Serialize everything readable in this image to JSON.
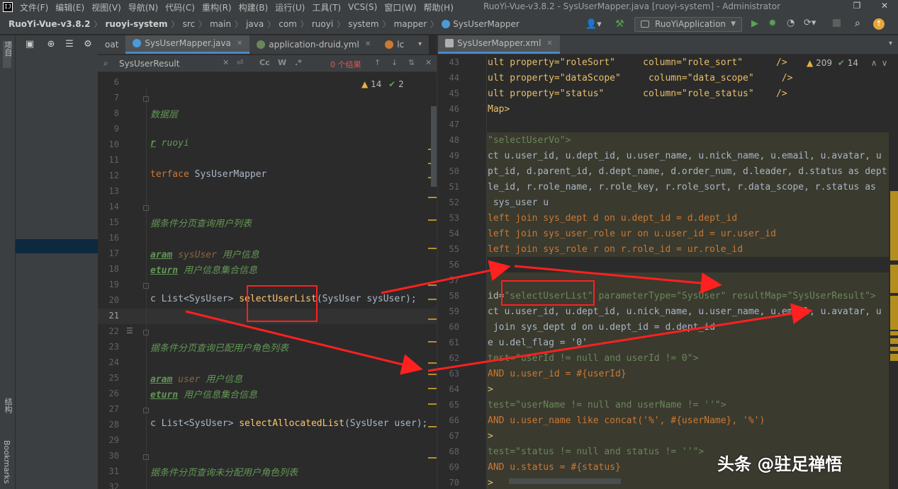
{
  "menubar": {
    "items": [
      "文件(F)",
      "编辑(E)",
      "视图(V)",
      "导航(N)",
      "代码(C)",
      "重构(R)",
      "构建(B)",
      "运行(U)",
      "工具(T)",
      "VCS(S)",
      "窗口(W)",
      "帮助(H)"
    ],
    "window_title": "RuoYi-Vue-v3.8.2 - SysUserMapper.java [ruoyi-system] - Administrator"
  },
  "breadcrumb": [
    "RuoYi-Vue-v3.8.2",
    "ruoyi-system",
    "src",
    "main",
    "java",
    "com",
    "ruoyi",
    "system",
    "mapper",
    "SysUserMapper"
  ],
  "run_config": {
    "label": "RuoYiApplication"
  },
  "side_labels": {
    "project": "项目",
    "structure": "结构",
    "bookmarks": "Bookmarks"
  },
  "left_tabs": [
    {
      "label": "oat",
      "icon_color": "#6a8759"
    },
    {
      "label": "SysUserMapper.java",
      "icon_color": "#4a9bd8",
      "active": true
    },
    {
      "label": "application-druid.yml",
      "icon_color": "#6a8759"
    },
    {
      "label": "lc",
      "icon_color": "#cc7832"
    }
  ],
  "right_tabs": [
    {
      "label": "SysUserMapper.xml",
      "active": true
    }
  ],
  "search": {
    "value": "SysUserResult",
    "result_count": "0 个结果",
    "tool_cc": "Cc",
    "tool_w": "W",
    "tool_regex": ".*"
  },
  "left_inspection": {
    "warnings": "14",
    "ok": "2"
  },
  "right_inspection": {
    "warnings": "209",
    "ok": "14"
  },
  "left_code": {
    "line_numbers": [
      "6",
      "7",
      "8",
      "9",
      "10",
      "11",
      "12",
      "13",
      "14",
      "15",
      "16",
      "17",
      "18",
      "19",
      "20",
      "21",
      "22",
      "23",
      "24",
      "25",
      "26",
      "27",
      "28",
      "29",
      "30",
      "31",
      "32"
    ],
    "l8": "数据层",
    "l10_tag": "r",
    "l10_text": " ruoyi",
    "l12_kw": "terface",
    "l12_name": " SysUserMapper",
    "l15": "据条件分页查询用户列表",
    "l17_tag": "aram",
    "l17_param": " sysUser",
    "l17_text": " 用户信息",
    "l18_tag": "eturn",
    "l18_text": " 用户信息集合信息",
    "l20_pre": "c List<SysUser> ",
    "l20_fn": "selectUserList",
    "l20_post": "(SysUser sysUser);",
    "l23": "据条件分页查询已配用户角色列表",
    "l25_tag": "aram",
    "l25_param": " user",
    "l25_text": " 用户信息",
    "l26_tag": "eturn",
    "l26_text": " 用户信息集合信息",
    "l28_pre": "c List<SysUser> ",
    "l28_fn": "selectAllocatedList",
    "l28_post": "(SysUser user);",
    "l31": "据条件分页查询未分配用户角色列表"
  },
  "right_code": {
    "line_numbers": [
      "43",
      "44",
      "45",
      "46",
      "47",
      "48",
      "49",
      "50",
      "51",
      "52",
      "53",
      "54",
      "55",
      "56",
      "57",
      "58",
      "59",
      "60",
      "61",
      "62",
      "63",
      "64",
      "65",
      "66",
      "67",
      "68",
      "69",
      "70"
    ],
    "l43": "ult property=\"roleSort\"     column=\"role_sort\"      />",
    "l44": "ult property=\"dataScope\"     column=\"data_scope\"     />",
    "l45": "ult property=\"status\"       column=\"role_status\"    />",
    "l46": "Map>",
    "l48": "\"selectUserVo\">",
    "l49": "ct u.user_id, u.dept_id, u.user_name, u.nick_name, u.email, u.avatar, u",
    "l50": "pt_id, d.parent_id, d.dept_name, d.order_num, d.leader, d.status as dept",
    "l51": "le_id, r.role_name, r.role_key, r.role_sort, r.data_scope, r.status as",
    "l52": " sys_user u",
    "l53": "left join sys_dept d on u.dept_id = d.dept_id",
    "l54": "left join sys_user_role ur on u.user_id = ur.user_id",
    "l55": "left join sys_role r on r.role_id = ur.role_id",
    "l58_pre": "id=",
    "l58_id": "\"selectUserList\"",
    "l58_post": " parameterType=\"SysUser\" resultMap=\"SysUserResult\">",
    "l59": "ct u.user_id, u.dept_id, u.nick_name, u.user_name, u.email, u.avatar, u",
    "l60": " join sys_dept d on u.dept_id = d.dept_id",
    "l61": "e u.del_flag = '0'",
    "l62": "test=\"userId != null and userId != 0\">",
    "l63": "AND u.user_id = #{userId}",
    "l64": ">",
    "l65": "test=\"userName != null and userName != ''\">",
    "l66": "AND u.user_name like concat('%', #{userName}, '%')",
    "l67": ">",
    "l68": "test=\"status != null and status != ''\">",
    "l69": "AND u.status = #{status}",
    "l70": ">"
  },
  "watermark": "头条 @驻足禅悟",
  "colors": {
    "accent": "#4a88c7",
    "annotation": "#ff2020",
    "warning": "#e8b243"
  }
}
